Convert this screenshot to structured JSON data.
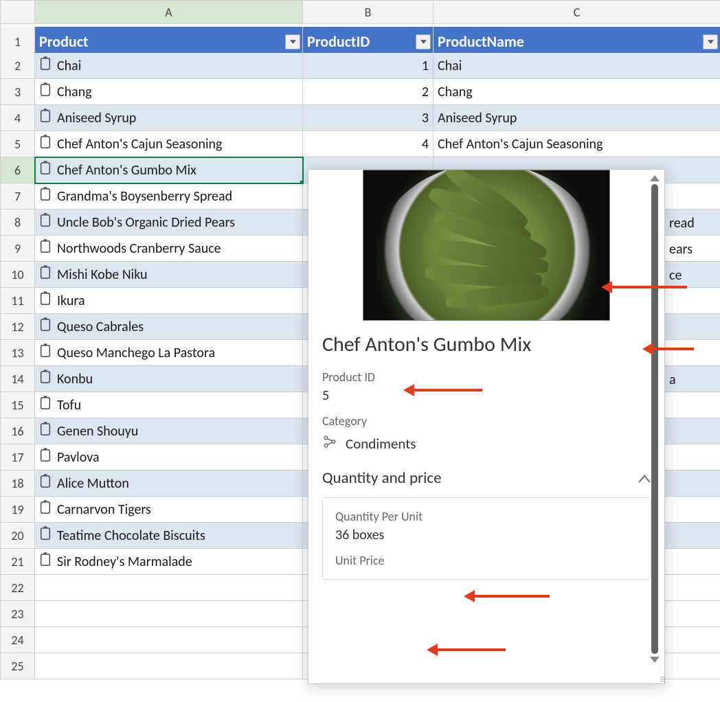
{
  "columns": {
    "corner": "",
    "A": "A",
    "B": "B",
    "C": "C"
  },
  "headers": {
    "product": "Product",
    "productId": "ProductID",
    "productName": "ProductName"
  },
  "rows": [
    {
      "n": "2",
      "product": "Chai",
      "id": "1",
      "name": "Chai"
    },
    {
      "n": "3",
      "product": "Chang",
      "id": "2",
      "name": "Chang"
    },
    {
      "n": "4",
      "product": "Aniseed Syrup",
      "id": "3",
      "name": "Aniseed Syrup"
    },
    {
      "n": "5",
      "product": "Chef Anton's Cajun Seasoning",
      "id": "4",
      "name": "Chef Anton's Cajun Seasoning"
    },
    {
      "n": "6",
      "product": "Chef Anton's Gumbo Mix",
      "id": "",
      "name": ""
    },
    {
      "n": "7",
      "product": "Grandma's Boysenberry Spread",
      "id": "",
      "name": "read"
    },
    {
      "n": "8",
      "product": "Uncle Bob's Organic Dried Pears",
      "id": "",
      "name": "ears"
    },
    {
      "n": "9",
      "product": "Northwoods Cranberry Sauce",
      "id": "",
      "name": "ce"
    },
    {
      "n": "10",
      "product": "Mishi Kobe Niku",
      "id": "",
      "name": ""
    },
    {
      "n": "11",
      "product": "Ikura",
      "id": "",
      "name": ""
    },
    {
      "n": "12",
      "product": "Queso Cabrales",
      "id": "",
      "name": ""
    },
    {
      "n": "13",
      "product": "Queso Manchego La Pastora",
      "id": "",
      "name": "a"
    },
    {
      "n": "14",
      "product": "Konbu",
      "id": "",
      "name": ""
    },
    {
      "n": "15",
      "product": "Tofu",
      "id": "",
      "name": ""
    },
    {
      "n": "16",
      "product": "Genen Shouyu",
      "id": "",
      "name": ""
    },
    {
      "n": "17",
      "product": "Pavlova",
      "id": "",
      "name": ""
    },
    {
      "n": "18",
      "product": "Alice Mutton",
      "id": "",
      "name": ""
    },
    {
      "n": "19",
      "product": "Carnarvon Tigers",
      "id": "",
      "name": ""
    },
    {
      "n": "20",
      "product": "Teatime Chocolate Biscuits",
      "id": "",
      "name": ""
    },
    {
      "n": "21",
      "product": "Sir Rodney's Marmalade",
      "id": "",
      "name": ""
    },
    {
      "n": "22",
      "product": "",
      "id": "",
      "name": ""
    },
    {
      "n": "23",
      "product": "",
      "id": "",
      "name": ""
    },
    {
      "n": "24",
      "product": "",
      "id": "",
      "name": ""
    },
    {
      "n": "25",
      "product": "",
      "id": "",
      "name": ""
    }
  ],
  "rowHeaders": {
    "r1": "1"
  },
  "selectedRow": "6",
  "card": {
    "title": "Chef Anton's Gumbo Mix",
    "productIdLabel": "Product ID",
    "productIdValue": "5",
    "categoryLabel": "Category",
    "categoryValue": "Condiments",
    "sectionTitle": "Quantity and price",
    "qpuLabel": "Quantity Per Unit",
    "qpuValue": "36 boxes",
    "unitPriceLabel": "Unit Price"
  }
}
